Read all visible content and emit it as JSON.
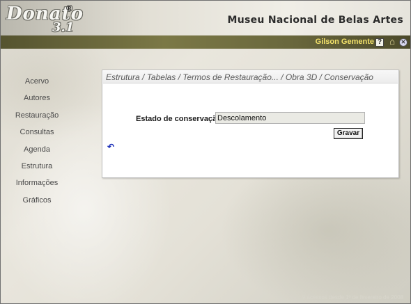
{
  "header": {
    "logo_text": "Donato",
    "logo_version": "3.1",
    "logo_registered": "®",
    "museum_title": "Museu Nacional de Belas Artes"
  },
  "userbar": {
    "username": "Gilson Gemente",
    "icons": [
      "help-icon",
      "home-icon",
      "close-icon"
    ],
    "help_glyph": "?",
    "home_glyph": "⌂",
    "close_glyph": "✕"
  },
  "sidebar": {
    "items": [
      {
        "label": "Acervo"
      },
      {
        "label": "Autores"
      },
      {
        "label": "Restauração"
      },
      {
        "label": "Consultas"
      },
      {
        "label": "Agenda"
      },
      {
        "label": "Estrutura"
      },
      {
        "label": "Informações"
      },
      {
        "label": "Gráficos"
      }
    ]
  },
  "main": {
    "breadcrumb": "Estrutura / Tabelas / Termos de Restauração... / Obra 3D / Conservação",
    "field_label": "Estado de conservação:",
    "field_value": "Descolamento",
    "save_label": "Gravar",
    "back_glyph": "↶"
  },
  "footer": {
    "text": "9 acessos desde 1º de fevereiro de 2008"
  },
  "colors": {
    "username": "#f4e36a",
    "userbar": "#6a683d",
    "back_icon": "#1c2fb8"
  }
}
